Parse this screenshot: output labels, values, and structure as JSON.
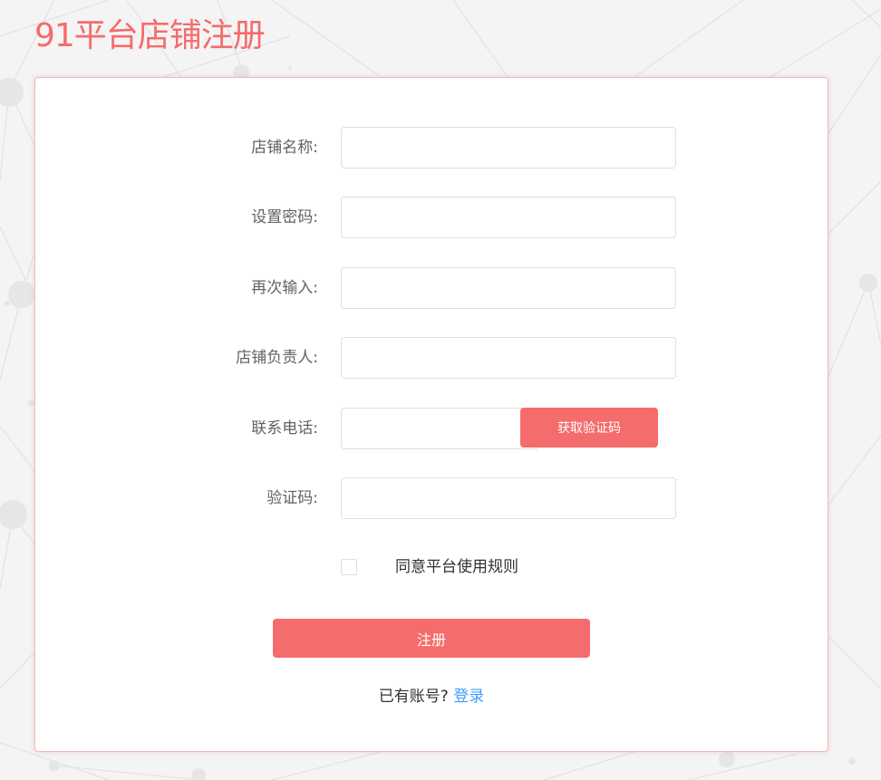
{
  "page": {
    "title": "91平台店铺注册"
  },
  "colors": {
    "accent": "#f56c6c",
    "link": "#409eff",
    "label": "#606266"
  },
  "form": {
    "shop_name": {
      "label": "店铺名称:",
      "value": "",
      "placeholder": ""
    },
    "password": {
      "label": "设置密码:",
      "value": "",
      "placeholder": ""
    },
    "password_confirm": {
      "label": "再次输入:",
      "value": "",
      "placeholder": ""
    },
    "owner": {
      "label": "店铺负责人:",
      "value": "",
      "placeholder": ""
    },
    "phone": {
      "label": "联系电话:",
      "value": "",
      "placeholder": "",
      "code_button": "获取验证码"
    },
    "verify_code": {
      "label": "验证码:",
      "value": "",
      "placeholder": ""
    },
    "agreement": {
      "label": "同意平台使用规则",
      "checked": false
    },
    "submit_label": "注册"
  },
  "footer": {
    "prompt": "已有账号?",
    "login_link": "登录"
  }
}
